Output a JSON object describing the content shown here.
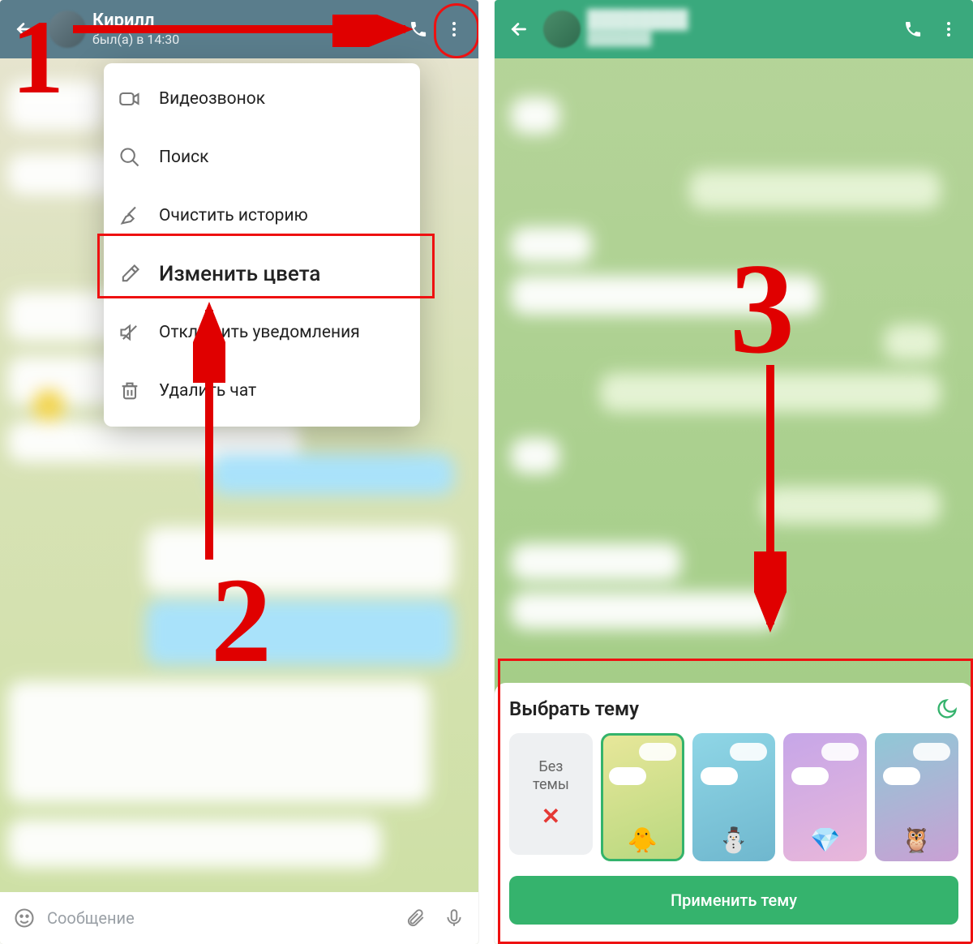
{
  "left": {
    "header": {
      "name": "Кирилл",
      "status": "был(а) в 14:30"
    },
    "menu": {
      "items": [
        {
          "icon": "videocam-icon",
          "label": "Видеозвонок"
        },
        {
          "icon": "search-icon",
          "label": "Поиск"
        },
        {
          "icon": "broom-icon",
          "label": "Очистить историю"
        },
        {
          "icon": "brush-icon",
          "label": "Изменить цвета"
        },
        {
          "icon": "mute-icon",
          "label": "Отключить уведомления"
        },
        {
          "icon": "trash-icon",
          "label": "Удалить чат"
        }
      ]
    },
    "input_placeholder": "Сообщение"
  },
  "right": {
    "sheet": {
      "title": "Выбрать тему",
      "no_theme_label": "Без\nтемы",
      "themes": [
        {
          "id": "none",
          "emoji": "✖",
          "bg": "#eef0f2"
        },
        {
          "id": "chick",
          "emoji": "🐥",
          "bg": "linear-gradient(160deg,#e8e79a,#b8d87f)",
          "selected": true
        },
        {
          "id": "snow",
          "emoji": "⛄",
          "bg": "linear-gradient(160deg,#8fd6e6,#6fb7ce)"
        },
        {
          "id": "gem",
          "emoji": "💎",
          "bg": "linear-gradient(160deg,#c6a6e8,#e9b7da)"
        },
        {
          "id": "owl",
          "emoji": "🦉",
          "bg": "linear-gradient(160deg,#8fc8d6,#c9a0d4)"
        }
      ],
      "apply_label": "Применить тему"
    }
  },
  "annotations": {
    "step1": "1",
    "step2": "2",
    "step3": "3"
  }
}
